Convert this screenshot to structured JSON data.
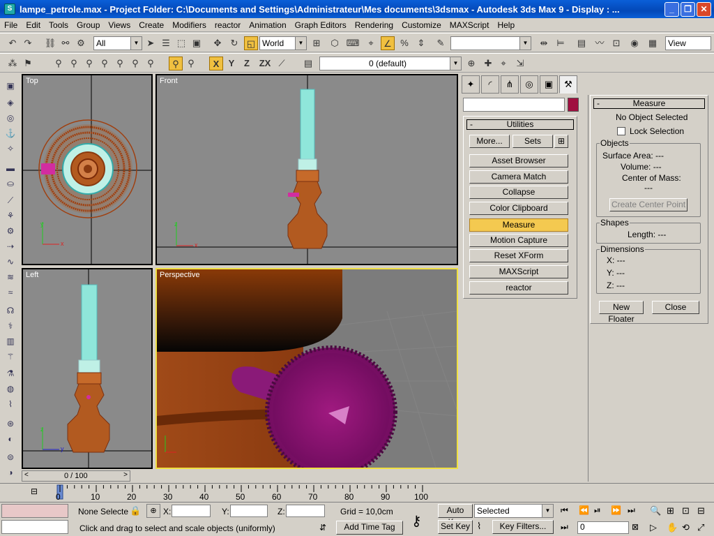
{
  "title": {
    "text": "lampe_petrole.max     - Project Folder: C:\\Documents and Settings\\Administrateur\\Mes documents\\3dsmax     - Autodesk 3ds Max 9     - Display : ...",
    "icon": "3ds-max-app-icon"
  },
  "menu": [
    "File",
    "Edit",
    "Tools",
    "Group",
    "Views",
    "Create",
    "Modifiers",
    "reactor",
    "Animation",
    "Graph Editors",
    "Rendering",
    "Customize",
    "MAXScript",
    "Help"
  ],
  "toolbar1": {
    "selection_filter": "All",
    "ref_coord": "World",
    "named_selection": "",
    "view_combo": "View"
  },
  "toolbar2": {
    "axis_x": "X",
    "axis_y": "Y",
    "axis_z": "Z",
    "axis_zx": "ZX",
    "layer": "0 (default)"
  },
  "viewports": {
    "top": "Top",
    "front": "Front",
    "left": "Left",
    "perspective": "Perspective"
  },
  "command_panel": {
    "utilities_header": "Utilities",
    "more_btn": "More...",
    "sets_btn": "Sets",
    "utilities": [
      "Asset Browser",
      "Camera Match",
      "Collapse",
      "Color Clipboard",
      "Measure",
      "Motion Capture",
      "Reset XForm",
      "MAXScript",
      "reactor"
    ],
    "selected_utility": "Measure",
    "swatch_color": "#a01040"
  },
  "measure": {
    "header": "Measure",
    "status": "No Object Selected",
    "lock_selection": "Lock Selection",
    "objects_group": "Objects",
    "surface_area": "Surface Area: ---",
    "volume": "Volume: ---",
    "center_of_mass": "Center of Mass:",
    "center_value": "---",
    "create_center_point": "Create Center Point",
    "shapes_group": "Shapes",
    "length": "Length: ---",
    "dimensions_group": "Dimensions",
    "dim_x": "X:  ---",
    "dim_y": "Y:  ---",
    "dim_z": "Z:  ---",
    "new_floater": "New Floater",
    "close": "Close"
  },
  "timeline": {
    "frame_counter": "0 / 100",
    "ticks": [
      "0",
      "10",
      "20",
      "30",
      "40",
      "50",
      "60",
      "70",
      "80",
      "90",
      "100"
    ]
  },
  "status": {
    "selection": "None Selecte",
    "x_label": "X:",
    "y_label": "Y:",
    "z_label": "Z:",
    "grid": "Grid = 10,0cm",
    "auto_key": "Auto Key",
    "set_key": "Set Key",
    "key_mode": "Selected",
    "key_filters": "Key Filters...",
    "current_frame": "0",
    "prompt": "Click and drag to select and scale objects (uniformly)",
    "add_time_tag": "Add Time Tag"
  }
}
